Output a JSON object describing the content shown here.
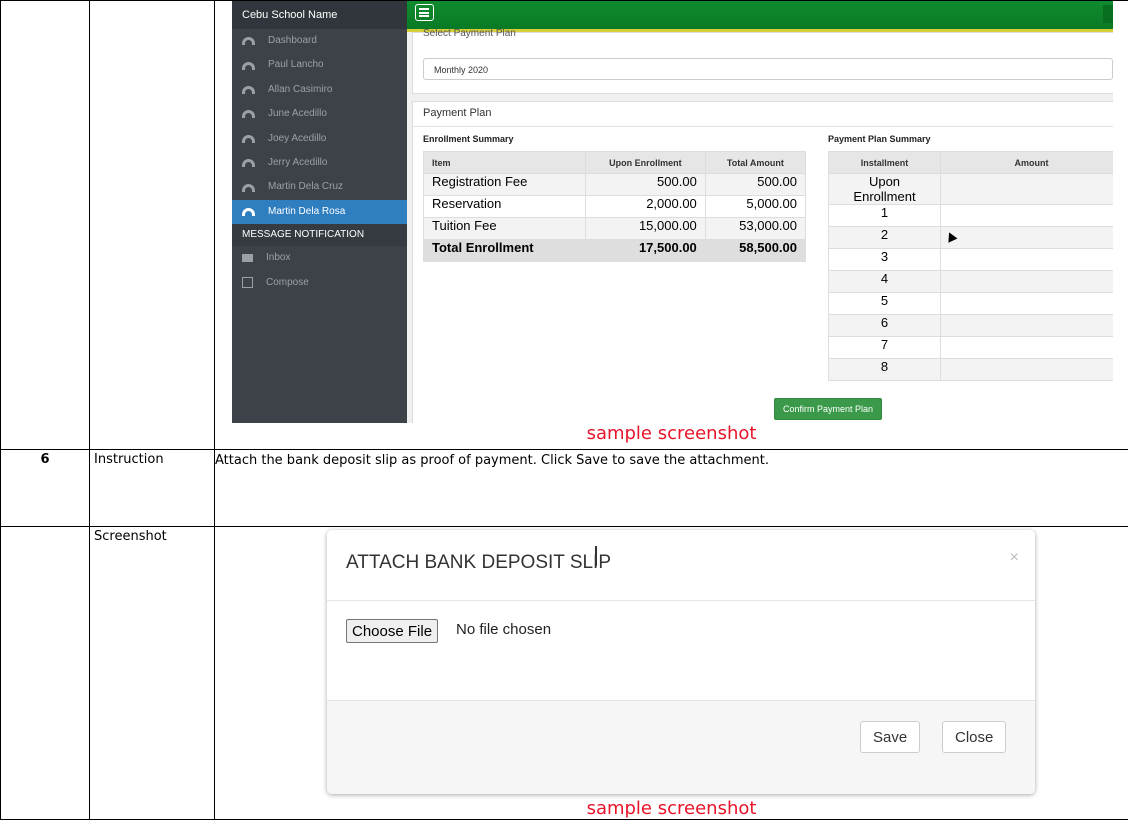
{
  "steps": {
    "first": {
      "app": {
        "brand": "Cebu School Name",
        "nav_items": [
          {
            "label": "Dashboard"
          },
          {
            "label": "Paul Lancho"
          },
          {
            "label": "Allan Casimiro"
          },
          {
            "label": "June Acedillo"
          },
          {
            "label": "Joey Acedillo"
          },
          {
            "label": "Jerry Acedillo"
          },
          {
            "label": "Martin Dela Cruz"
          },
          {
            "label": "Martin Dela Rosa"
          }
        ],
        "active_nav": "Martin Dela Rosa",
        "section_heading": "MESSAGE NOTIFICATION",
        "message_items": [
          {
            "label": "Inbox"
          },
          {
            "label": "Compose"
          }
        ],
        "select_label": "Select Payment Plan",
        "select_value": "Monthly 2020",
        "panel_title": "Payment Plan",
        "enrollment": {
          "title": "Enrollment Summary",
          "headers": [
            "Item",
            "Upon Enrollment",
            "Total Amount"
          ],
          "rows": [
            [
              "Registration Fee",
              "500.00",
              "500.00"
            ],
            [
              "Reservation",
              "2,000.00",
              "5,000.00"
            ],
            [
              "Tuition Fee",
              "15,000.00",
              "53,000.00"
            ]
          ],
          "total": [
            "Total Enrollment",
            "17,500.00",
            "58,500.00"
          ]
        },
        "payment_summary": {
          "title": "Payment Plan Summary",
          "headers": [
            "Installment",
            "Amount"
          ],
          "rows": [
            "Upon Enrollment",
            "1",
            "2",
            "3",
            "4",
            "5",
            "6",
            "7",
            "8"
          ]
        },
        "confirm_label": "Confirm Payment Plan",
        "accent_color": "#2f7ec0",
        "topbar_color": "#0f8b2e"
      },
      "caption": "sample screenshot"
    },
    "step6": {
      "number": "6",
      "instruction_label": "Instruction",
      "instruction_text": "Attach the bank deposit slip as proof of payment. Click Save to save the attachment.",
      "screenshot_label": "Screenshot",
      "dialog": {
        "title": "ATTACH BANK DEPOSIT SLIP",
        "close_glyph": "×",
        "file_button": "Choose File",
        "file_status": "No file chosen",
        "save_label": "Save",
        "close_label": "Close"
      },
      "caption": "sample screenshot"
    }
  }
}
